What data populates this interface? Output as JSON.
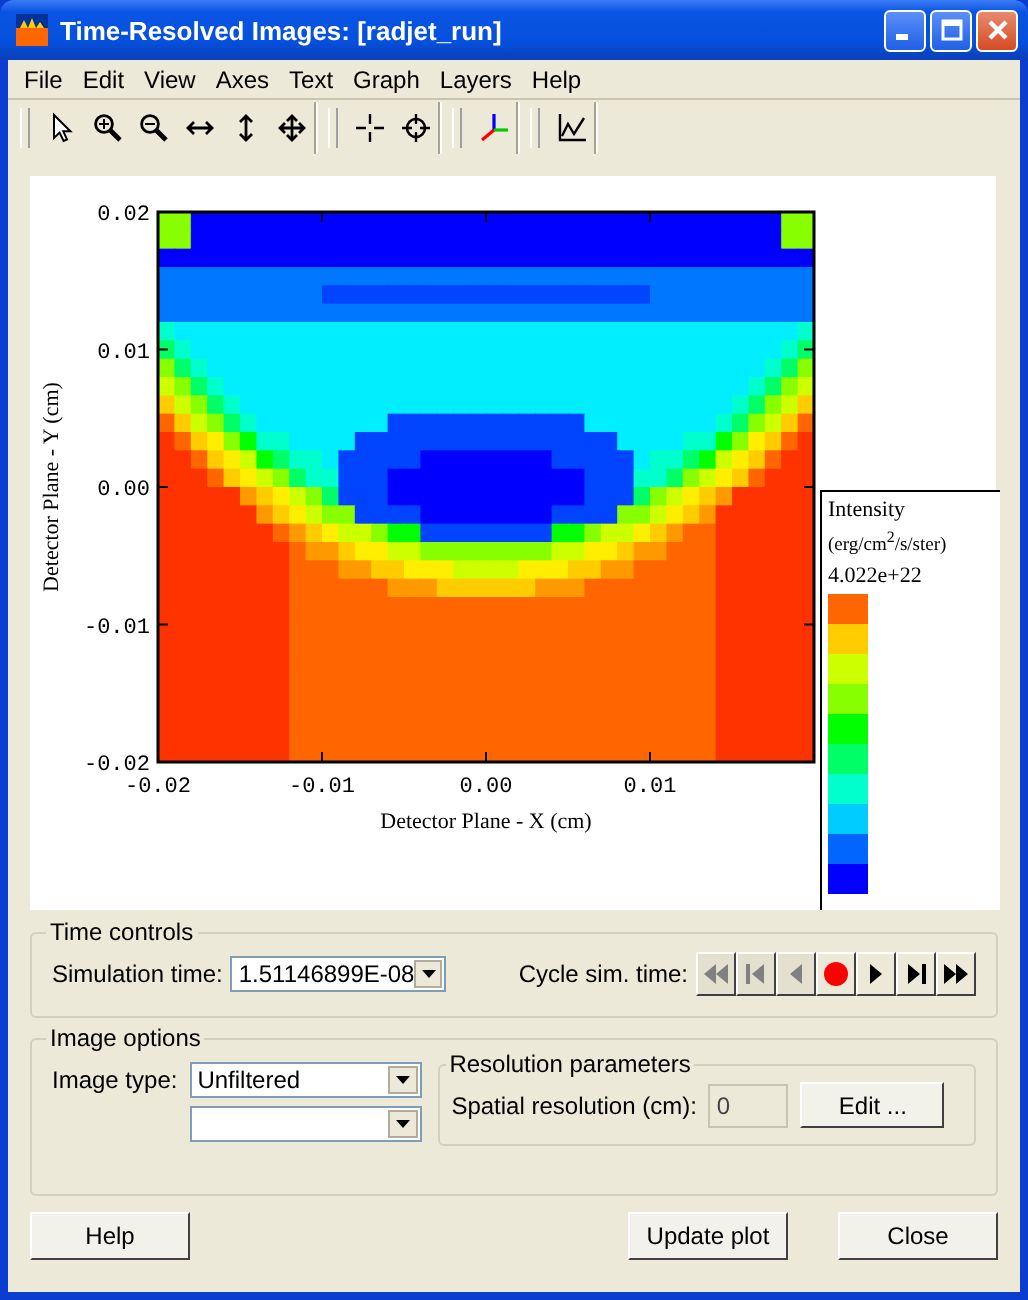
{
  "window": {
    "title": "Time-Resolved Images: [radjet_run]"
  },
  "menu": [
    "File",
    "Edit",
    "View",
    "Axes",
    "Text",
    "Graph",
    "Layers",
    "Help"
  ],
  "plot": {
    "y_ticks": [
      "0.02",
      "0.01",
      "0.00",
      "-0.01",
      "-0.02"
    ],
    "x_ticks": [
      "-0.02",
      "-0.01",
      "0.00",
      "0.01"
    ],
    "xlabel": "Detector Plane - X (cm)",
    "ylabel": "Detector Plane - Y (cm)",
    "legend": {
      "title": "Intensity",
      "units": "(erg/cm$^{2}$/s/ster)",
      "max": "4.022e+22"
    }
  },
  "time_controls": {
    "title": "Time controls",
    "sim_label": "Simulation time:",
    "sim_value": "1.51146899E-08",
    "cycle_label": "Cycle sim. time:",
    "cycle_buttons": [
      {
        "disabled": true
      },
      {
        "disabled": true
      },
      {
        "disabled": true
      },
      {
        "disabled": false
      },
      {
        "disabled": false
      },
      {
        "disabled": false
      },
      {
        "disabled": false
      }
    ]
  },
  "image_options": {
    "title": "Image options",
    "type_label": "Image type:",
    "type_value": "Unfiltered",
    "resolution": {
      "title": "Resolution parameters",
      "label": "Spatial resolution (cm):",
      "value": "0",
      "disabled": true,
      "edit_button": "Edit ..."
    }
  },
  "buttons": [
    "Help",
    "Update plot",
    "Close"
  ]
}
